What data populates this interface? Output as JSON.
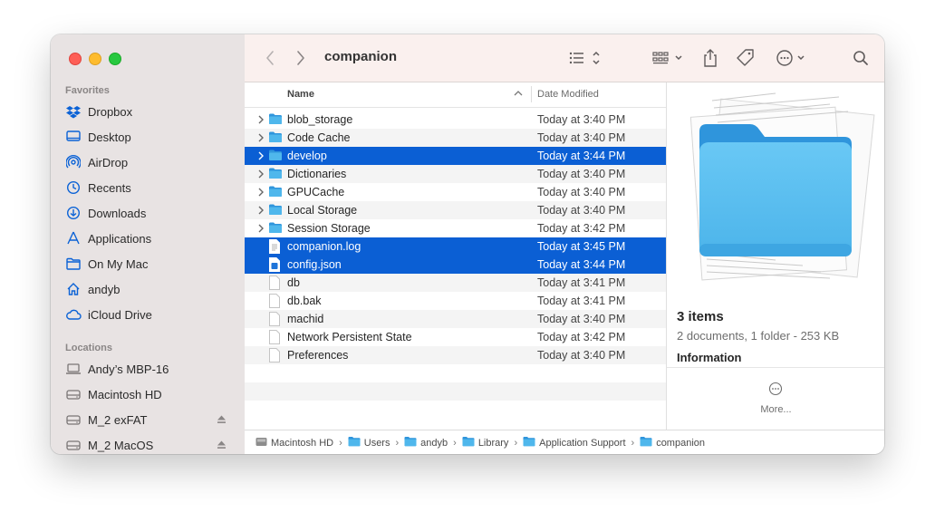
{
  "window": {
    "title": "companion"
  },
  "sidebar": {
    "favorites_label": "Favorites",
    "favorites": [
      {
        "label": "Dropbox",
        "icon": "dropbox-icon"
      },
      {
        "label": "Desktop",
        "icon": "desktop-icon"
      },
      {
        "label": "AirDrop",
        "icon": "airdrop-icon"
      },
      {
        "label": "Recents",
        "icon": "clock-icon"
      },
      {
        "label": "Downloads",
        "icon": "download-icon"
      },
      {
        "label": "Applications",
        "icon": "applications-icon"
      },
      {
        "label": "On My Mac",
        "icon": "folder-icon"
      },
      {
        "label": "andyb",
        "icon": "home-icon"
      },
      {
        "label": "iCloud Drive",
        "icon": "cloud-icon"
      }
    ],
    "locations_label": "Locations",
    "locations": [
      {
        "label": "Andy’s MBP-16",
        "icon": "laptop-icon",
        "eject": false
      },
      {
        "label": "Macintosh HD",
        "icon": "drive-icon",
        "eject": false
      },
      {
        "label": "M_2 exFAT",
        "icon": "drive-icon",
        "eject": true
      },
      {
        "label": "M_2 MacOS",
        "icon": "drive-icon",
        "eject": true
      }
    ]
  },
  "columns": {
    "name": "Name",
    "date": "Date Modified"
  },
  "files": [
    {
      "name": "blob_storage",
      "date": "Today at 3:40 PM",
      "kind": "folder",
      "selected": false
    },
    {
      "name": "Code Cache",
      "date": "Today at 3:40 PM",
      "kind": "folder",
      "selected": false
    },
    {
      "name": "develop",
      "date": "Today at 3:44 PM",
      "kind": "folder",
      "selected": true
    },
    {
      "name": "Dictionaries",
      "date": "Today at 3:40 PM",
      "kind": "folder",
      "selected": false
    },
    {
      "name": "GPUCache",
      "date": "Today at 3:40 PM",
      "kind": "folder",
      "selected": false
    },
    {
      "name": "Local Storage",
      "date": "Today at 3:40 PM",
      "kind": "folder",
      "selected": false
    },
    {
      "name": "Session Storage",
      "date": "Today at 3:42 PM",
      "kind": "folder",
      "selected": false
    },
    {
      "name": "companion.log",
      "date": "Today at 3:45 PM",
      "kind": "log",
      "selected": true
    },
    {
      "name": "config.json",
      "date": "Today at 3:44 PM",
      "kind": "json",
      "selected": true
    },
    {
      "name": "db",
      "date": "Today at 3:41 PM",
      "kind": "file",
      "selected": false
    },
    {
      "name": "db.bak",
      "date": "Today at 3:41 PM",
      "kind": "file",
      "selected": false
    },
    {
      "name": "machid",
      "date": "Today at 3:40 PM",
      "kind": "file",
      "selected": false
    },
    {
      "name": "Network Persistent State",
      "date": "Today at 3:42 PM",
      "kind": "file",
      "selected": false
    },
    {
      "name": "Preferences",
      "date": "Today at 3:40 PM",
      "kind": "file",
      "selected": false
    }
  ],
  "preview": {
    "title": "3 items",
    "subtitle": "2 documents, 1 folder - 253 KB",
    "info_label": "Information",
    "more_label": "More..."
  },
  "pathbar": [
    {
      "label": "Macintosh HD",
      "icon": "drive-icon"
    },
    {
      "label": "Users",
      "icon": "folder-icon"
    },
    {
      "label": "andyb",
      "icon": "home-folder-icon"
    },
    {
      "label": "Library",
      "icon": "folder-icon"
    },
    {
      "label": "Application Support",
      "icon": "folder-icon"
    },
    {
      "label": "companion",
      "icon": "folder-icon"
    }
  ],
  "colors": {
    "selection": "#0b5fd4",
    "folder": "#4fb7ec",
    "sidebar_accent": "#0b62d6"
  }
}
